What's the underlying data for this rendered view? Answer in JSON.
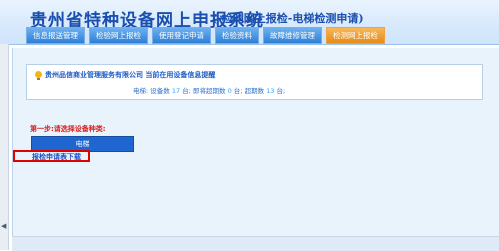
{
  "app": {
    "title": "贵州省特种设备网上申报系统",
    "subtitle": "(-检测网上报检-电梯检测申请)"
  },
  "nav": {
    "tabs": [
      {
        "label": "信息报送管理",
        "active": false
      },
      {
        "label": "检验网上报检",
        "active": false
      },
      {
        "label": "使用登记申请",
        "active": false
      },
      {
        "label": "检验资料",
        "active": false
      },
      {
        "label": "故障维修管理",
        "active": false
      },
      {
        "label": "检测网上报检",
        "active": true
      }
    ]
  },
  "info": {
    "company_line": "贵州品信商业管理服务有限公司 当前在用设备信息提醒",
    "category_label": "电梯:",
    "device_count_label": "设备数",
    "device_count": "17",
    "unit": "台;",
    "expiring_label": "即将超期数",
    "expiring_count": "0",
    "overdue_label": "超期数",
    "overdue_count": "13"
  },
  "step": {
    "text": "第一步:请选择设备种类:",
    "elevator_button": "电梯",
    "download_link": "报检申请表下载"
  },
  "colors": {
    "brand_blue": "#1a4fb0",
    "tab_blue": "#2d7fd6",
    "tab_active": "#e58a17",
    "alert_red": "#d51f1f"
  }
}
